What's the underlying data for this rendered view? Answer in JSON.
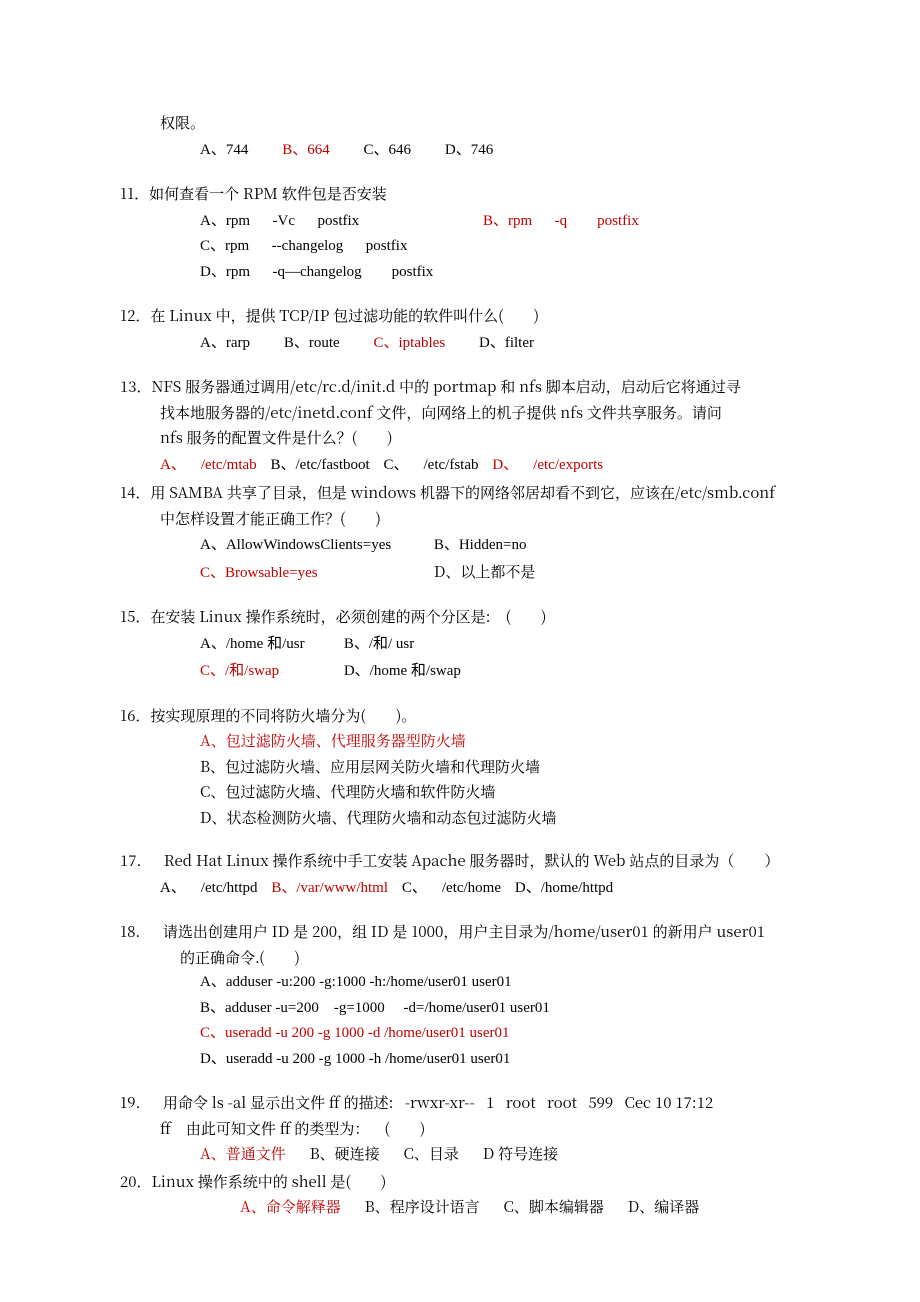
{
  "q10": {
    "cont": "权限。",
    "a": "A、744",
    "b": "B、664",
    "c": "C、646",
    "d": "D、746"
  },
  "q11": {
    "stem": "11．如何查看一个 RPM 软件包是否安装",
    "a": "A、rpm  -Vc  postfix",
    "b": "B、rpm  -q  postfix",
    "c": "C、rpm  --changelog  postfix",
    "d": "D、rpm  -q—changelog  postfix"
  },
  "q12": {
    "stem": "12．在 Linux 中，提供 TCP/IP 包过滤功能的软件叫什么(  )",
    "a": "A、rarp",
    "b": "B、route",
    "c": "C、iptables",
    "d": "D、filter"
  },
  "q13": {
    "stem1": "13．NFS 服务器通过调用/etc/rc.d/init.d 中的 portmap 和 nfs 脚本启动，启动后它将通过寻",
    "stem2": "找本地服务器的/etc/inetd.conf 文件，向网络上的机子提供 nfs 文件共享服务。请问",
    "stem3": "nfs 服务的配置文件是什么？(  )",
    "a": "A、 /etc/mtab",
    "b": "B、/etc/fastboot",
    "c": "C、 /etc/fstab",
    "d": "D、 /etc/exports"
  },
  "q14": {
    "stem1": "14．用 SAMBA 共享了目录，但是 windows 机器下的网络邻居却看不到它，应该在/etc/smb.conf",
    "stem2": "中怎样设置才能正确工作？(  )",
    "a": "A、AllowWindowsClients=yes",
    "b": "B、Hidden=no",
    "c": "C、Browsable=yes",
    "d": "D、以上都不是"
  },
  "q15": {
    "stem": "15．在安装 Linux 操作系统时，必须创建的两个分区是: (  )",
    "a": "A、/home 和/usr",
    "b": "B、/和/ usr",
    "c": "C、/和/swap",
    "d": "D、/home 和/swap"
  },
  "q16": {
    "stem": "16．按实现原理的不同将防火墙分为(  )。",
    "a": "A、包过滤防火墙、代理服务器型防火墙",
    "b": "B、包过滤防火墙、应用层网关防火墙和代理防火墙",
    "c": "C、包过滤防火墙、代理防火墙和软件防火墙",
    "d": "D、状态检测防火墙、代理防火墙和动态包过滤防火墙"
  },
  "q17": {
    "stem": "17.  Red Hat Linux 操作系统中手工安装 Apache 服务器时，默认的 Web 站点的目录为（  ）",
    "a": "A、 /etc/httpd",
    "b": "B、/var/www/html",
    "c": "C、 /etc/home",
    "d": "D、/home/httpd"
  },
  "q18": {
    "stem1": "18.  请选出创建用户 ID 是 200，组 ID 是 1000，用户主目录为/home/user01 的新用户 user01",
    "stem2": "的正确命令.(  )",
    "a": "A、adduser -u:200 -g:1000 -h:/home/user01 user01",
    "b": "B、adduser -u=200 -g=1000  -d=/home/user01 user01",
    "c": "C、useradd -u 200 -g 1000 -d /home/user01 user01",
    "d": "D、useradd -u 200 -g 1000 -h /home/user01 user01"
  },
  "q19": {
    "stem1": "19.  用命令 ls -al 显示出文件 ff 的描述:  -rwxr-xr--  1  root  root  599  Cec 10 17:12",
    "stem2": "ff 由此可知文件 ff 的类型为： (  )",
    "a": "A、普通文件",
    "b": "B、硬连接",
    "c": "C、目录",
    "d": "D 符号连接"
  },
  "q20": {
    "stem": "20．Linux 操作系统中的 shell 是(  )",
    "a": "A、命令解释器",
    "b": "B、程序设计语言",
    "c": "C、脚本编辑器",
    "d": "D、编译器"
  }
}
